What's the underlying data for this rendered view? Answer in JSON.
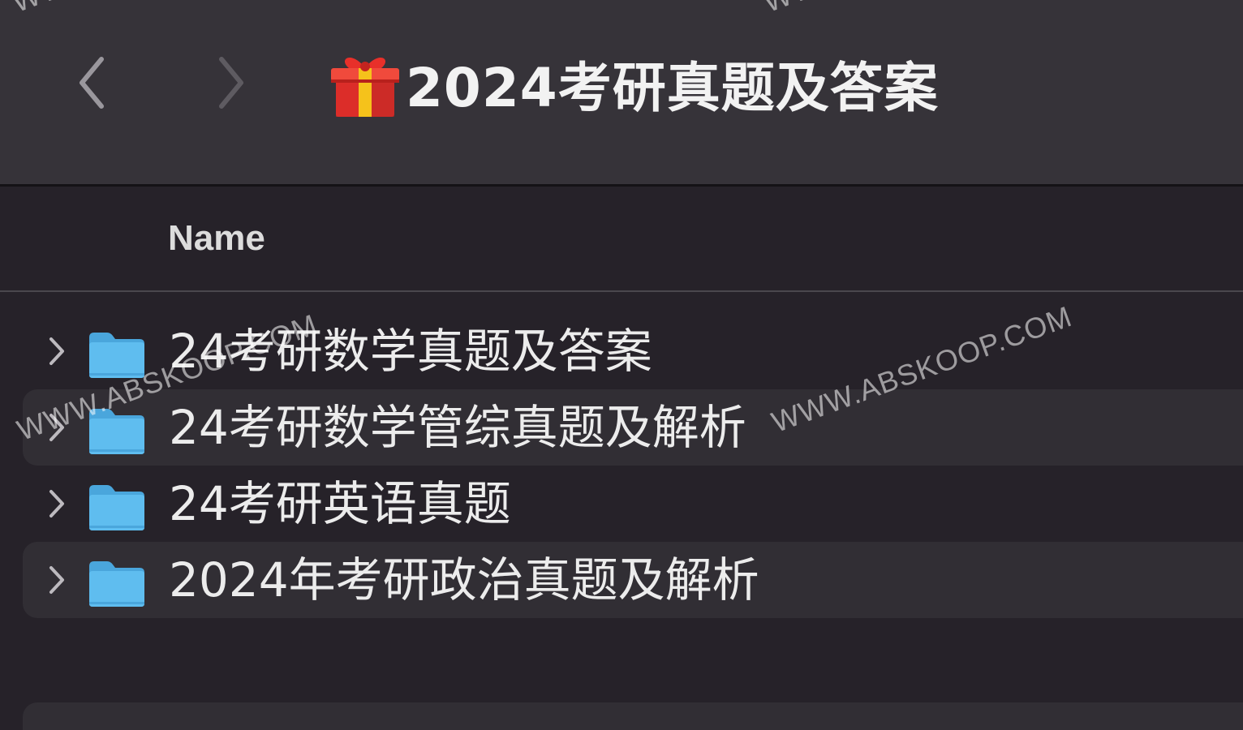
{
  "window": {
    "title": "2024考研真题及答案"
  },
  "toolbar": {
    "back_icon": "chevron-left-icon",
    "forward_icon": "chevron-right-icon",
    "title_icon": "gift-icon"
  },
  "list_header": {
    "name_column": "Name"
  },
  "files": [
    {
      "name": "24考研数学真题及答案",
      "type": "folder",
      "expanded": false
    },
    {
      "name": "24考研数学管综真题及解析",
      "type": "folder",
      "expanded": false
    },
    {
      "name": "24考研英语真题",
      "type": "folder",
      "expanded": false
    },
    {
      "name": "2024年考研政治真题及解析",
      "type": "folder",
      "expanded": false
    }
  ],
  "watermarks": [
    "WWW.ABSKOOP.COM",
    "WWW.ABSKOOP.COM",
    "WWW",
    "WWW"
  ],
  "colors": {
    "folder": "#5ab8ea",
    "titlebar": "#363339",
    "background": "#262229",
    "alt_row": "#312e34"
  }
}
